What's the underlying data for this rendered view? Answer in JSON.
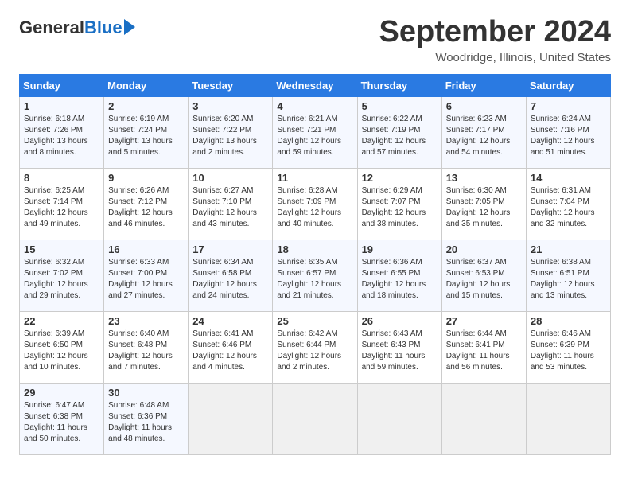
{
  "logo": {
    "general": "General",
    "blue": "Blue"
  },
  "title": "September 2024",
  "location": "Woodridge, Illinois, United States",
  "days_header": [
    "Sunday",
    "Monday",
    "Tuesday",
    "Wednesday",
    "Thursday",
    "Friday",
    "Saturday"
  ],
  "weeks": [
    [
      {
        "day": "1",
        "sunrise": "Sunrise: 6:18 AM",
        "sunset": "Sunset: 7:26 PM",
        "daylight": "Daylight: 13 hours and 8 minutes."
      },
      {
        "day": "2",
        "sunrise": "Sunrise: 6:19 AM",
        "sunset": "Sunset: 7:24 PM",
        "daylight": "Daylight: 13 hours and 5 minutes."
      },
      {
        "day": "3",
        "sunrise": "Sunrise: 6:20 AM",
        "sunset": "Sunset: 7:22 PM",
        "daylight": "Daylight: 13 hours and 2 minutes."
      },
      {
        "day": "4",
        "sunrise": "Sunrise: 6:21 AM",
        "sunset": "Sunset: 7:21 PM",
        "daylight": "Daylight: 12 hours and 59 minutes."
      },
      {
        "day": "5",
        "sunrise": "Sunrise: 6:22 AM",
        "sunset": "Sunset: 7:19 PM",
        "daylight": "Daylight: 12 hours and 57 minutes."
      },
      {
        "day": "6",
        "sunrise": "Sunrise: 6:23 AM",
        "sunset": "Sunset: 7:17 PM",
        "daylight": "Daylight: 12 hours and 54 minutes."
      },
      {
        "day": "7",
        "sunrise": "Sunrise: 6:24 AM",
        "sunset": "Sunset: 7:16 PM",
        "daylight": "Daylight: 12 hours and 51 minutes."
      }
    ],
    [
      {
        "day": "8",
        "sunrise": "Sunrise: 6:25 AM",
        "sunset": "Sunset: 7:14 PM",
        "daylight": "Daylight: 12 hours and 49 minutes."
      },
      {
        "day": "9",
        "sunrise": "Sunrise: 6:26 AM",
        "sunset": "Sunset: 7:12 PM",
        "daylight": "Daylight: 12 hours and 46 minutes."
      },
      {
        "day": "10",
        "sunrise": "Sunrise: 6:27 AM",
        "sunset": "Sunset: 7:10 PM",
        "daylight": "Daylight: 12 hours and 43 minutes."
      },
      {
        "day": "11",
        "sunrise": "Sunrise: 6:28 AM",
        "sunset": "Sunset: 7:09 PM",
        "daylight": "Daylight: 12 hours and 40 minutes."
      },
      {
        "day": "12",
        "sunrise": "Sunrise: 6:29 AM",
        "sunset": "Sunset: 7:07 PM",
        "daylight": "Daylight: 12 hours and 38 minutes."
      },
      {
        "day": "13",
        "sunrise": "Sunrise: 6:30 AM",
        "sunset": "Sunset: 7:05 PM",
        "daylight": "Daylight: 12 hours and 35 minutes."
      },
      {
        "day": "14",
        "sunrise": "Sunrise: 6:31 AM",
        "sunset": "Sunset: 7:04 PM",
        "daylight": "Daylight: 12 hours and 32 minutes."
      }
    ],
    [
      {
        "day": "15",
        "sunrise": "Sunrise: 6:32 AM",
        "sunset": "Sunset: 7:02 PM",
        "daylight": "Daylight: 12 hours and 29 minutes."
      },
      {
        "day": "16",
        "sunrise": "Sunrise: 6:33 AM",
        "sunset": "Sunset: 7:00 PM",
        "daylight": "Daylight: 12 hours and 27 minutes."
      },
      {
        "day": "17",
        "sunrise": "Sunrise: 6:34 AM",
        "sunset": "Sunset: 6:58 PM",
        "daylight": "Daylight: 12 hours and 24 minutes."
      },
      {
        "day": "18",
        "sunrise": "Sunrise: 6:35 AM",
        "sunset": "Sunset: 6:57 PM",
        "daylight": "Daylight: 12 hours and 21 minutes."
      },
      {
        "day": "19",
        "sunrise": "Sunrise: 6:36 AM",
        "sunset": "Sunset: 6:55 PM",
        "daylight": "Daylight: 12 hours and 18 minutes."
      },
      {
        "day": "20",
        "sunrise": "Sunrise: 6:37 AM",
        "sunset": "Sunset: 6:53 PM",
        "daylight": "Daylight: 12 hours and 15 minutes."
      },
      {
        "day": "21",
        "sunrise": "Sunrise: 6:38 AM",
        "sunset": "Sunset: 6:51 PM",
        "daylight": "Daylight: 12 hours and 13 minutes."
      }
    ],
    [
      {
        "day": "22",
        "sunrise": "Sunrise: 6:39 AM",
        "sunset": "Sunset: 6:50 PM",
        "daylight": "Daylight: 12 hours and 10 minutes."
      },
      {
        "day": "23",
        "sunrise": "Sunrise: 6:40 AM",
        "sunset": "Sunset: 6:48 PM",
        "daylight": "Daylight: 12 hours and 7 minutes."
      },
      {
        "day": "24",
        "sunrise": "Sunrise: 6:41 AM",
        "sunset": "Sunset: 6:46 PM",
        "daylight": "Daylight: 12 hours and 4 minutes."
      },
      {
        "day": "25",
        "sunrise": "Sunrise: 6:42 AM",
        "sunset": "Sunset: 6:44 PM",
        "daylight": "Daylight: 12 hours and 2 minutes."
      },
      {
        "day": "26",
        "sunrise": "Sunrise: 6:43 AM",
        "sunset": "Sunset: 6:43 PM",
        "daylight": "Daylight: 11 hours and 59 minutes."
      },
      {
        "day": "27",
        "sunrise": "Sunrise: 6:44 AM",
        "sunset": "Sunset: 6:41 PM",
        "daylight": "Daylight: 11 hours and 56 minutes."
      },
      {
        "day": "28",
        "sunrise": "Sunrise: 6:46 AM",
        "sunset": "Sunset: 6:39 PM",
        "daylight": "Daylight: 11 hours and 53 minutes."
      }
    ],
    [
      {
        "day": "29",
        "sunrise": "Sunrise: 6:47 AM",
        "sunset": "Sunset: 6:38 PM",
        "daylight": "Daylight: 11 hours and 50 minutes."
      },
      {
        "day": "30",
        "sunrise": "Sunrise: 6:48 AM",
        "sunset": "Sunset: 6:36 PM",
        "daylight": "Daylight: 11 hours and 48 minutes."
      },
      null,
      null,
      null,
      null,
      null
    ]
  ]
}
